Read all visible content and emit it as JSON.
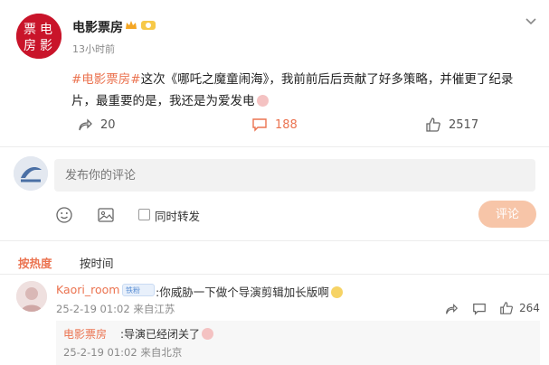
{
  "post": {
    "author": "电影票房",
    "avatar_text": "票电影房",
    "time": "13小时前",
    "tag": "#电影票房#",
    "body": "这次《哪吒之魔童闹海》，我前前后后贡献了好多策略，并催更了纪录片，最重要的是，我还是为爱发电",
    "actions": {
      "share_count": "20",
      "comment_count": "188",
      "like_count": "2517"
    }
  },
  "composer": {
    "placeholder": "发布你的评论",
    "repost_label": "同时转发",
    "submit_label": "评论"
  },
  "sort": {
    "hot": "按热度",
    "time": "按时间"
  },
  "comments": [
    {
      "user": "Kaori_room",
      "badge": "铁粉",
      "text": ":你威胁一下做个导演剪辑加长版啊",
      "meta": "25-2-19 01:02 来自江苏",
      "like_count": "264",
      "reply": {
        "user": "电影票房",
        "text": ":导演已经闭关了",
        "meta": "25-2-19 01:02 来自北京"
      }
    }
  ],
  "colors": {
    "accent": "#eb7350",
    "avatar_red": "#c9142a",
    "submit_disabled": "#f7c5a8"
  },
  "icons": {
    "header_menu": "chevron-down-icon",
    "share": "repost-icon",
    "comment": "comment-icon",
    "like": "thumbs-up-icon",
    "emoji": "smile-icon",
    "image": "image-icon"
  }
}
